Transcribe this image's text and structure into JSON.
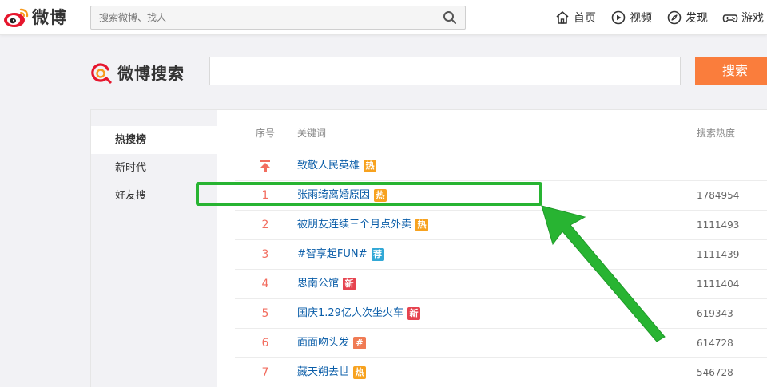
{
  "topbar": {
    "brand": "微博",
    "search_placeholder": "搜索微博、找人",
    "nav": [
      {
        "label": "首页",
        "icon": "home-icon"
      },
      {
        "label": "视频",
        "icon": "video-icon"
      },
      {
        "label": "发现",
        "icon": "compass-icon"
      },
      {
        "label": "游戏",
        "icon": "gamepad-icon"
      }
    ]
  },
  "search_header": {
    "title": "微博搜索",
    "input_value": "",
    "button_label": "搜索"
  },
  "sidebar": {
    "items": [
      {
        "label": "热搜榜",
        "active": true
      },
      {
        "label": "新时代",
        "active": false
      },
      {
        "label": "好友搜",
        "active": false
      }
    ]
  },
  "table": {
    "headers": {
      "rank": "序号",
      "keyword": "关键词",
      "heat": "搜索热度"
    },
    "rows": [
      {
        "rank": "",
        "pinned": true,
        "keyword": "致敬人民英雄",
        "badge": "热",
        "badge_color": "#f7a21f",
        "heat": ""
      },
      {
        "rank": "1",
        "keyword": "张雨绮离婚原因",
        "badge": "热",
        "badge_color": "#f7a21f",
        "heat": "1784954"
      },
      {
        "rank": "2",
        "keyword": "被朋友连续三个月点外卖",
        "badge": "热",
        "badge_color": "#f7a21f",
        "heat": "1111493"
      },
      {
        "rank": "3",
        "keyword": "#智享起FUN#",
        "badge": "荐",
        "badge_color": "#32a8d6",
        "heat": "1111439"
      },
      {
        "rank": "4",
        "keyword": "思南公馆",
        "badge": "新",
        "badge_color": "#e6434f",
        "heat": "1111404"
      },
      {
        "rank": "5",
        "keyword": "国庆1.29亿人次坐火车",
        "badge": "新",
        "badge_color": "#e6434f",
        "heat": "619343"
      },
      {
        "rank": "6",
        "keyword": "面面吻头发",
        "badge": "#",
        "badge_color": "#f07b54",
        "heat": "614728"
      },
      {
        "rank": "7",
        "keyword": "藏天朔去世",
        "badge": "热",
        "badge_color": "#f7a21f",
        "heat": "546728"
      }
    ]
  },
  "colors": {
    "accent_orange": "#fa7d3c",
    "highlight_green": "#28b432",
    "rank_red": "#f26d5f",
    "link_blue": "#0a5da8"
  }
}
